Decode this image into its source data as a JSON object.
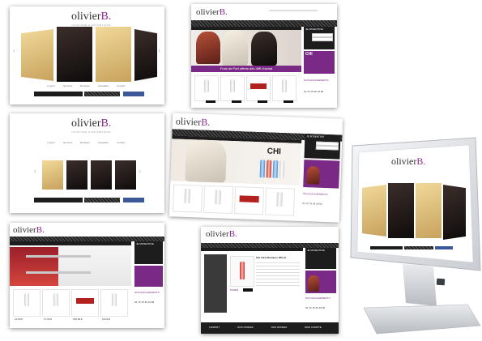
{
  "brand": {
    "logo_name": "olivier",
    "logo_letter": "B.",
    "logo_tagline": "COIFFURE & ESTHÉTIQUE"
  },
  "nav": [
    "L'esprit",
    "Services",
    "Boutique",
    "Actualités",
    "Contact"
  ],
  "menu_tabs": [
    "Shampooings",
    "Soins",
    "Coiffants",
    "Accessoires",
    "Lissage"
  ],
  "banner_promo": "Frais de Port offerts dès 49€ d'achat",
  "chi_brand": "CHI",
  "sidebar": {
    "identification_title": "JE M'IDENTIFIE",
    "newsletter_title": "RECEVEZ NOTRE NEWSLETTER",
    "engagements_title": "NOS ENGAGEMENTS",
    "phone_label": "RESERVATION DE RDV",
    "phone": "01 76 75 45 19 56"
  },
  "products": [
    {
      "name": "Shampooing Chi Color",
      "price": "21,90 €"
    },
    {
      "name": "Shampooing Chi Infra",
      "price": "17,90 €"
    },
    {
      "name": "Fer à lisser CHI Hairs",
      "price": "159,00 €"
    },
    {
      "name": "Shampooing Chi 355 ml",
      "price": "18,00 €"
    }
  ],
  "footer": [
    "L'ESPRIT",
    "NOS OFFRES",
    "NOS OFFRES",
    "MON COMPTE"
  ],
  "detail": {
    "title": "CHI Infra Shampoo 355 ml",
    "price": "17,90 €"
  },
  "colors": {
    "brand_purple": "#8b2a8f",
    "dark": "#1d1d1d",
    "accent_red": "#b4221f"
  }
}
